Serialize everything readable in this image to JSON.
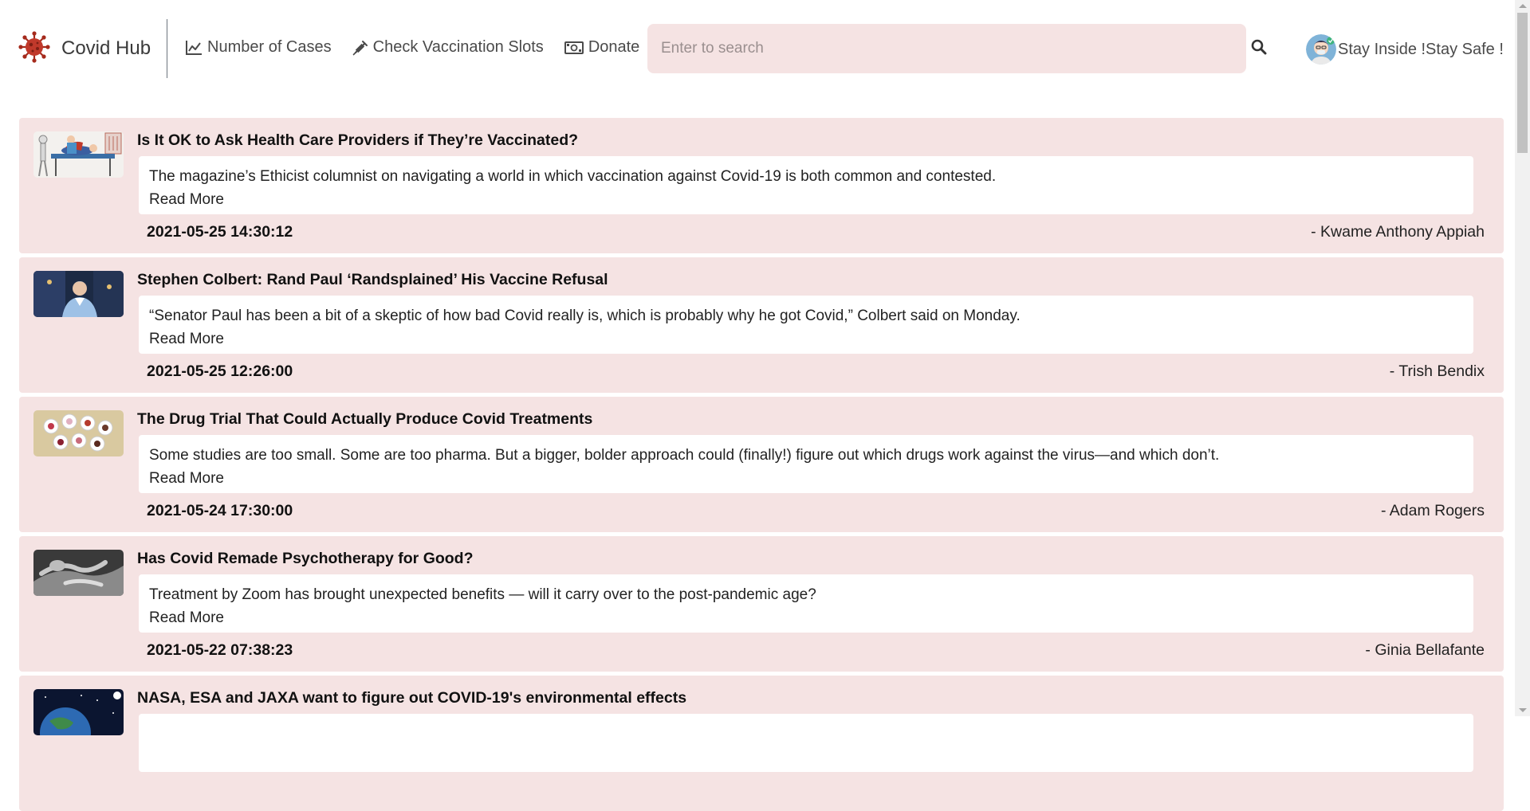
{
  "brand": {
    "name": "Covid Hub",
    "icon": "virus-icon",
    "color": "#c0392b"
  },
  "nav": {
    "cases": {
      "label": "Number of Cases",
      "icon": "line-chart-icon"
    },
    "vaccination": {
      "label": "Check Vaccination Slots",
      "icon": "syringe-icon"
    },
    "donate": {
      "label": "Donate",
      "icon": "money-bill-icon"
    }
  },
  "search": {
    "placeholder": "Enter to search",
    "value": "",
    "icon": "search-icon"
  },
  "user": {
    "text": "Stay Inside !Stay Safe !",
    "icon": "avatar-icon"
  },
  "colors": {
    "card_bg": "#f5e3e3",
    "search_bg": "#f5e3e3",
    "text": "#212529"
  },
  "articles": [
    {
      "title": "Is It OK to Ask Health Care Providers if They’re Vaccinated?",
      "description": "The magazine’s Ethicist columnist on navigating a world in which vaccination against Covid-19 is both common and contested.",
      "read_more": "Read More",
      "date": "2021-05-25 14:30:12",
      "author": "- Kwame Anthony Appiah"
    },
    {
      "title": "Stephen Colbert: Rand Paul ‘Randsplained’ His Vaccine Refusal",
      "description": "“Senator Paul has been a bit of a skeptic of how bad Covid really is, which is probably why he got Covid,” Colbert said on Monday.",
      "read_more": "Read More",
      "date": "2021-05-25 12:26:00",
      "author": "- Trish Bendix"
    },
    {
      "title": "The Drug Trial That Could Actually Produce Covid Treatments",
      "description": "Some studies are too small. Some are too pharma. But a bigger, bolder approach could (finally!) figure out which drugs work against the virus—and which don’t.",
      "read_more": "Read More",
      "date": "2021-05-24 17:30:00",
      "author": "- Adam Rogers"
    },
    {
      "title": "Has Covid Remade Psychotherapy for Good?",
      "description": "Treatment by Zoom has brought unexpected benefits — will it carry over to the post-pandemic age?",
      "read_more": "Read More",
      "date": "2021-05-22 07:38:23",
      "author": "- Ginia Bellafante"
    },
    {
      "title": "NASA, ESA and JAXA want to figure out COVID-19's environmental effects"
    }
  ]
}
